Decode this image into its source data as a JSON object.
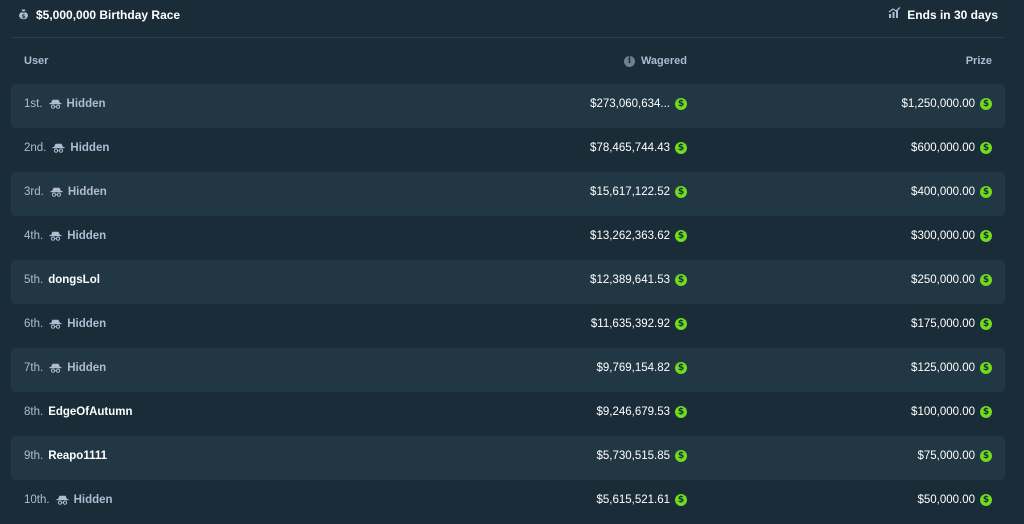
{
  "race": {
    "title": "$5,000,000 Birthday Race",
    "title_icon": "money-bag-icon",
    "ends_in": "Ends in 30 days",
    "ends_icon": "chart-icon"
  },
  "table": {
    "headers": {
      "user": "User",
      "wagered": "Wagered",
      "prize": "Prize"
    },
    "currency_symbol": "$",
    "colors": {
      "background": "#1a2c38",
      "row_alt": "#213743",
      "coin": "#6fdc1e",
      "text_primary": "#ffffff",
      "text_secondary": "#b1bad3"
    },
    "rows": [
      {
        "rank": "1st.",
        "name": "Hidden",
        "hidden": true,
        "wagered": "$273,060,634...",
        "prize": "$1,250,000.00"
      },
      {
        "rank": "2nd.",
        "name": "Hidden",
        "hidden": true,
        "wagered": "$78,465,744.43",
        "prize": "$600,000.00"
      },
      {
        "rank": "3rd.",
        "name": "Hidden",
        "hidden": true,
        "wagered": "$15,617,122.52",
        "prize": "$400,000.00"
      },
      {
        "rank": "4th.",
        "name": "Hidden",
        "hidden": true,
        "wagered": "$13,262,363.62",
        "prize": "$300,000.00"
      },
      {
        "rank": "5th.",
        "name": "dongsLol",
        "hidden": false,
        "wagered": "$12,389,641.53",
        "prize": "$250,000.00"
      },
      {
        "rank": "6th.",
        "name": "Hidden",
        "hidden": true,
        "wagered": "$11,635,392.92",
        "prize": "$175,000.00"
      },
      {
        "rank": "7th.",
        "name": "Hidden",
        "hidden": true,
        "wagered": "$9,769,154.82",
        "prize": "$125,000.00"
      },
      {
        "rank": "8th.",
        "name": "EdgeOfAutumn",
        "hidden": false,
        "wagered": "$9,246,679.53",
        "prize": "$100,000.00"
      },
      {
        "rank": "9th.",
        "name": "Reapo1111",
        "hidden": false,
        "wagered": "$5,730,515.85",
        "prize": "$75,000.00"
      },
      {
        "rank": "10th.",
        "name": "Hidden",
        "hidden": true,
        "wagered": "$5,615,521.61",
        "prize": "$50,000.00"
      }
    ]
  }
}
